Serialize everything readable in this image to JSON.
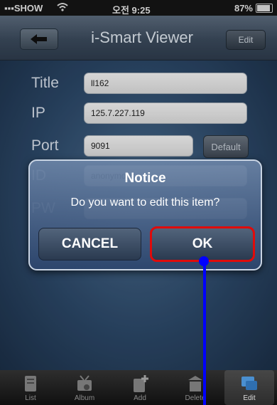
{
  "status_bar": {
    "carrier": "SHOW",
    "time": "오전 9:25",
    "battery": "87%"
  },
  "nav": {
    "title": "i-Smart Viewer",
    "edit_label": "Edit",
    "back_icon": "back-arrow-icon"
  },
  "form": {
    "rows": [
      {
        "label": "Title",
        "value": "ll162"
      },
      {
        "label": "IP",
        "value": "125.7.227.119"
      },
      {
        "label": "Port",
        "value": "9091"
      },
      {
        "label": "ID",
        "value": "anonymous"
      },
      {
        "label": "PW",
        "value": ""
      }
    ],
    "default_label": "Default"
  },
  "dialog": {
    "title": "Notice",
    "message": "Do you want to edit this item?",
    "cancel_label": "CANCEL",
    "ok_label": "OK"
  },
  "tabbar": {
    "tabs": [
      {
        "label": "List",
        "icon": "list-icon"
      },
      {
        "label": "Album",
        "icon": "album-icon"
      },
      {
        "label": "Add",
        "icon": "add-icon"
      },
      {
        "label": "Delete",
        "icon": "delete-icon"
      },
      {
        "label": "Edit",
        "icon": "edit-icon"
      }
    ]
  },
  "colors": {
    "highlight": "#e00b0b",
    "annotation": "#0000ff"
  }
}
